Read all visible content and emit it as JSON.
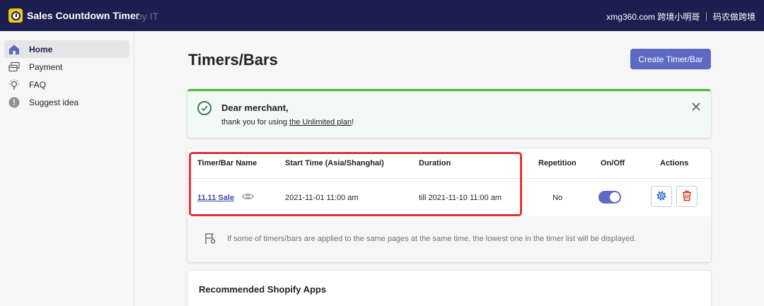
{
  "topbar": {
    "app_title": "Sales Countdown Timer",
    "by_label": "by IT",
    "right_text": "xmg360.com 跨境小明哥 ｜ 码农做跨境",
    "logo_icon": "alarm-clock-icon"
  },
  "sidebar": {
    "items": [
      {
        "label": "Home",
        "icon": "home-icon",
        "active": true
      },
      {
        "label": "Payment",
        "icon": "payment-icon",
        "active": false
      },
      {
        "label": "FAQ",
        "icon": "lightbulb-icon",
        "active": false
      },
      {
        "label": "Suggest idea",
        "icon": "alert-circle-icon",
        "active": false
      }
    ]
  },
  "page": {
    "title": "Timers/Bars",
    "create_button": "Create Timer/Bar"
  },
  "banner": {
    "title": "Dear merchant,",
    "text_before": "thank you for using ",
    "link": "the Unlimited plan",
    "text_after": "!"
  },
  "table": {
    "headers": {
      "name": "Timer/Bar Name",
      "start": "Start Time (Asia/Shanghai)",
      "duration": "Duration",
      "repetition": "Repetition",
      "onoff": "On/Off",
      "actions": "Actions"
    },
    "row": {
      "name": "11.11 Sale",
      "start": "2021-11-01 11:00 am",
      "duration": "till 2021-11-10 11:00 am",
      "repetition": "No",
      "enabled": true
    },
    "note": "If some of timers/bars are applied to the same pages at the same time, the lowest one in the timer list will be displayed."
  },
  "recommended": {
    "title": "Recommended Shopify Apps"
  },
  "colors": {
    "topbar": "#1c1f4f",
    "primary": "#5c6ac4",
    "success": "#50b83c",
    "danger": "#d82c0d",
    "highlight": "#e0333a"
  }
}
